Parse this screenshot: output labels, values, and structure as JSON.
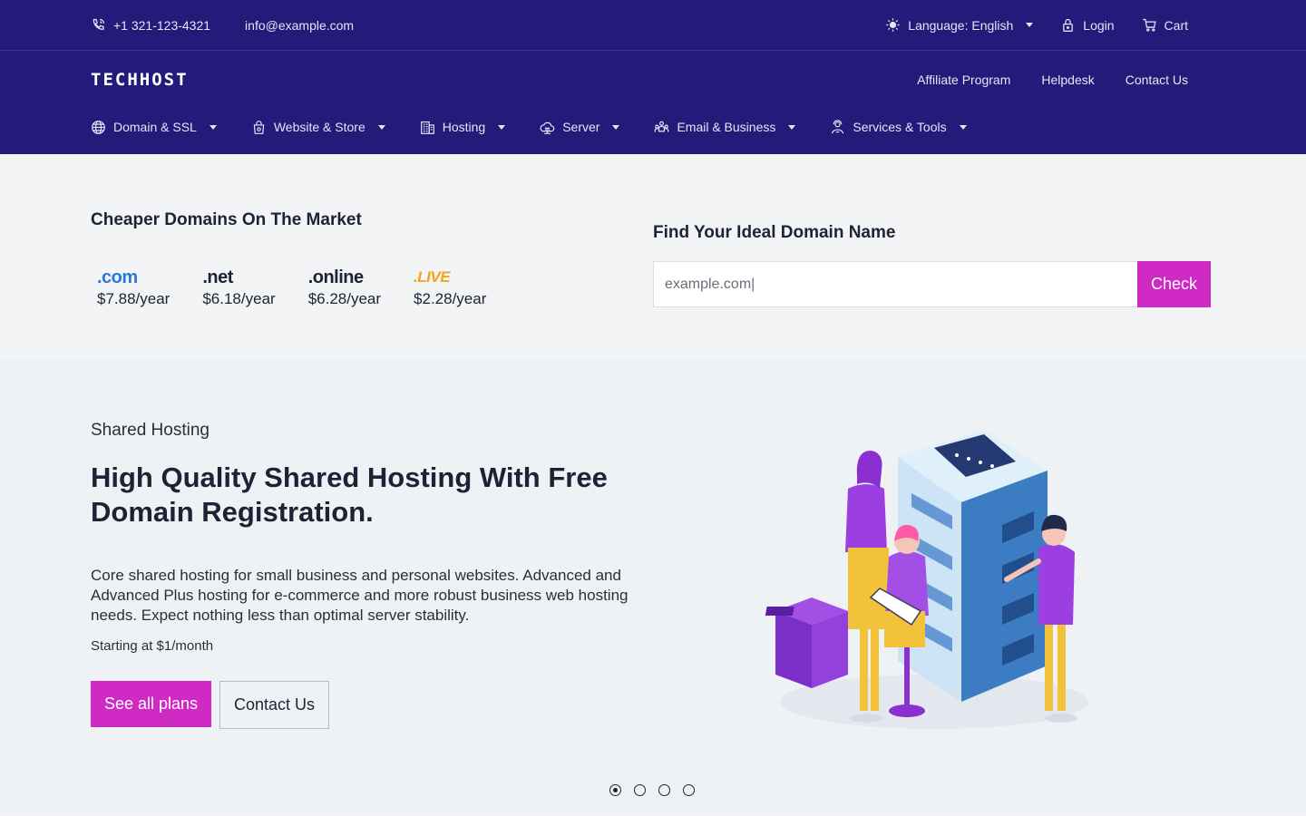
{
  "topbar": {
    "phone": "+1 321-123-4321",
    "email": "info@example.com",
    "language": "Language: English",
    "login": "Login",
    "cart": "Cart"
  },
  "header": {
    "logo": "TECHHOST",
    "util_links": [
      "Affiliate Program",
      "Helpdesk",
      "Contact Us"
    ],
    "nav": [
      "Domain & SSL",
      "Website & Store",
      "Hosting",
      "Server",
      "Email & Business",
      "Services & Tools"
    ]
  },
  "domains": {
    "title": "Cheaper Domains On The Market",
    "tlds": [
      {
        "name": ".com",
        "price": "$7.88/year",
        "color": "#2a78d6"
      },
      {
        "name": ".net",
        "price": "$6.18/year",
        "color": "#1e2235"
      },
      {
        "name": ".online",
        "price": "$6.28/year",
        "color": "#1e2235"
      },
      {
        "name": ".LIVE",
        "price": "$2.28/year",
        "color": "#f1a51b"
      }
    ]
  },
  "search": {
    "title": "Find Your Ideal Domain Name",
    "placeholder": "example.com|",
    "button": "Check"
  },
  "hero": {
    "eyebrow": "Shared Hosting",
    "title": "High Quality Shared Hosting With Free Domain Registration.",
    "description": "Core shared hosting for small business and personal websites. Advanced and Advanced Plus hosting for e-commerce and more robust business web hosting needs. Expect nothing less than optimal server stability.",
    "price": "Starting at $1/month",
    "primary_button": "See all plans",
    "secondary_button": "Contact Us"
  },
  "carousel": {
    "active_index": 0,
    "count": 4
  },
  "colors": {
    "brand": "#231a7a",
    "accent": "#cf2bc4"
  }
}
